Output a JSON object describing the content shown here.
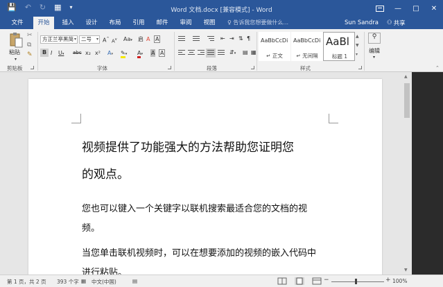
{
  "window": {
    "title": "Word 文档.docx [兼容模式] - Word",
    "qat": {
      "save_icon": "save-icon",
      "undo_icon": "undo-icon",
      "redo_icon": "redo-icon",
      "customize_icon": "customize-qat-icon"
    }
  },
  "tabs": [
    "文件",
    "开始",
    "插入",
    "设计",
    "布局",
    "引用",
    "邮件",
    "审阅",
    "视图"
  ],
  "active_tab": "开始",
  "tell_me": "♀ 告诉我您想要做什么...",
  "user": "Sun Sandra",
  "share": "共享",
  "ribbon": {
    "clipboard": {
      "paste": "粘贴",
      "label": "剪贴板"
    },
    "font": {
      "font_name": "方正兰亭黑简",
      "font_size": "二号",
      "grow": "A",
      "shrink": "A",
      "change_case": "Aa",
      "clear": "A",
      "bold": "B",
      "italic": "I",
      "underline": "U",
      "strike": "abc",
      "subscript": "x₂",
      "superscript": "x²",
      "highlight": "A",
      "color": "A",
      "char_shading": "A",
      "enclose": "A",
      "label": "字体"
    },
    "paragraph": {
      "label": "段落"
    },
    "styles": {
      "items": [
        {
          "sample": "AaBbCcDi",
          "name": "↵ 正文"
        },
        {
          "sample": "AaBbCcDi",
          "name": "↵ 无间隔"
        },
        {
          "sample": "AaBl",
          "name": "标题 1"
        }
      ],
      "label": "样式"
    },
    "editing": {
      "label": "编辑"
    }
  },
  "document": {
    "heading_line1": "视频提供了功能强大的方法帮助您证明您",
    "heading_line2": "的观点。",
    "para1_line1": "您也可以键入一个关键字以联机搜索最适合您的文档的视",
    "para1_line2": "频。",
    "para2_line1": "当您单击联机视频时，可以在想要添加的视频的嵌入代码中",
    "para2_line2": "进行粘贴。"
  },
  "status": {
    "page": "第 1 页，共 2 页",
    "words": "393 个字",
    "language": "中文(中国)",
    "zoom": "100%",
    "zoom_minus": "−",
    "zoom_plus": "+"
  },
  "colors": {
    "accent": "#2b579a",
    "highlight": "#f5e800",
    "font_color": "#d01e1e"
  }
}
